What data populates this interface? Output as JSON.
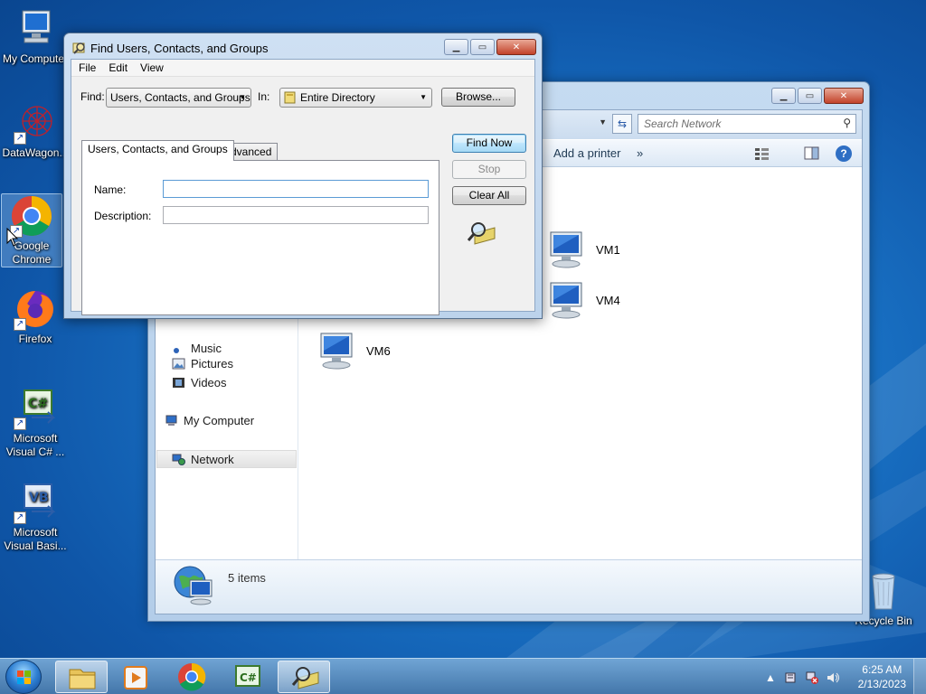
{
  "desktop": {
    "icons": [
      {
        "label": "My Computer",
        "icon": "computer-icon"
      },
      {
        "label": "DataWagon...",
        "icon": "datawagon-icon"
      },
      {
        "label": "Google Chrome",
        "icon": "chrome-icon"
      },
      {
        "label": "Firefox",
        "icon": "firefox-icon"
      },
      {
        "label": "Microsoft Visual C# ...",
        "icon": "visual-csharp-icon"
      },
      {
        "label": "Microsoft Visual Basi...",
        "icon": "visual-basic-icon"
      },
      {
        "label": "Recycle Bin",
        "icon": "recycle-bin-icon"
      }
    ]
  },
  "explorer": {
    "search_placeholder": "Search Network",
    "toolbar": {
      "add_printer": "Add a printer",
      "more": "»"
    },
    "nav": {
      "music": "Music",
      "pictures": "Pictures",
      "videos": "Videos",
      "my_computer": "My Computer",
      "network": "Network"
    },
    "items": [
      {
        "name": "VM1"
      },
      {
        "name": "VM4"
      },
      {
        "name": "VM6"
      }
    ],
    "status": "5 items"
  },
  "find_dialog": {
    "title": "Find Users, Contacts, and Groups",
    "menu": [
      "File",
      "Edit",
      "View"
    ],
    "find_label": "Find:",
    "find_value": "Users, Contacts, and Groups",
    "in_label": "In:",
    "in_value": "Entire Directory",
    "browse_button": "Browse...",
    "tabs": [
      "Users, Contacts, and Groups",
      "Advanced"
    ],
    "name_label": "Name:",
    "name_value": "",
    "description_label": "Description:",
    "description_value": "",
    "find_now_button": "Find Now",
    "stop_button": "Stop",
    "clear_all_button": "Clear All"
  },
  "taskbar": {
    "clock_time": "6:25 AM",
    "clock_date": "2/13/2023",
    "pinned": [
      "explorer-icon",
      "media-player-icon",
      "chrome-icon",
      "visual-csharp-icon",
      "find-users-icon"
    ]
  }
}
